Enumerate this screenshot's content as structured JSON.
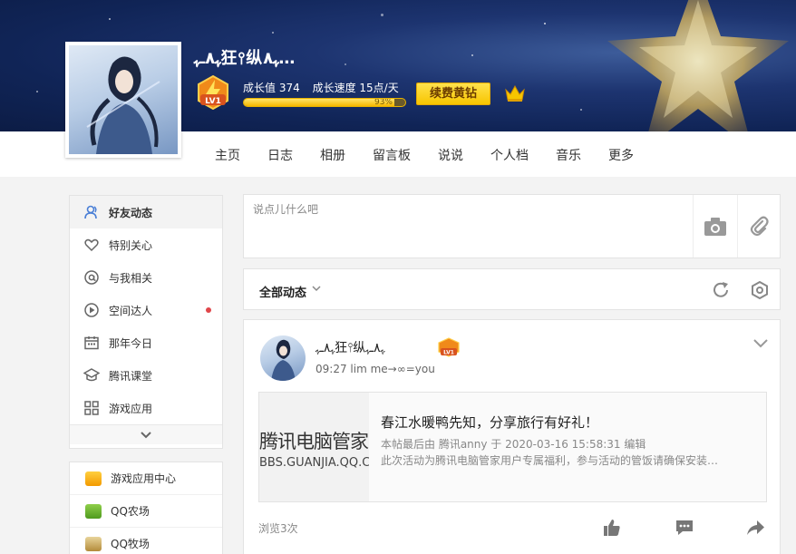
{
  "profile": {
    "nickname": "ﮩ٨ـﮩ狂⫯纵ﮩ٨…",
    "growth_value": "成长值 374",
    "growth_speed": "成长速度 15点/天",
    "progress_text": "93%",
    "progress_fraction": 0.93,
    "level_badge": "LV1",
    "renew_button": "续费黄钻"
  },
  "nav": {
    "items": [
      "主页",
      "日志",
      "相册",
      "留言板",
      "说说",
      "个人档",
      "音乐",
      "更多"
    ]
  },
  "sidebar": {
    "items": [
      {
        "label": "好友动态",
        "icon": "friends-icon",
        "active": true
      },
      {
        "label": "特别关心",
        "icon": "heart-icon"
      },
      {
        "label": "与我相关",
        "icon": "at-icon"
      },
      {
        "label": "空间达人",
        "icon": "play-icon",
        "badge": "red-dot"
      },
      {
        "label": "那年今日",
        "icon": "calendar-icon"
      },
      {
        "label": "腾讯课堂",
        "icon": "graduation-icon"
      },
      {
        "label": "游戏应用",
        "icon": "grid-icon"
      }
    ],
    "apps": [
      {
        "label": "游戏应用中心",
        "icon": "game-center-icon"
      },
      {
        "label": "QQ农场",
        "icon": "farm-icon"
      },
      {
        "label": "QQ牧场",
        "icon": "ranch-icon"
      }
    ]
  },
  "composer": {
    "placeholder": "说点儿什么吧"
  },
  "filter": {
    "label": "全部动态"
  },
  "post": {
    "author": "ﮩ٨ـﮩ狂⫯纵ﮩ٨ـﮩ",
    "meta": "09:27  lim me→∞=you",
    "share": {
      "thumb_title": "腾讯电脑管家",
      "thumb_sub": "BBS.GUANJIA.QQ.COM",
      "title": "春江水暖鸭先知，分享旅行有好礼！",
      "edit_line": "本帖最后由 腾讯anny 于 2020-03-16 15:58:31 编辑",
      "desc": "此次活动为腾讯电脑管家用户专属福利，参与活动的管饭请确保安装…"
    },
    "views": "浏览3次"
  },
  "colors": {
    "accent_yellow": "#f7c500",
    "banner_blue": "#102456",
    "red_dot": "#e0464a"
  }
}
